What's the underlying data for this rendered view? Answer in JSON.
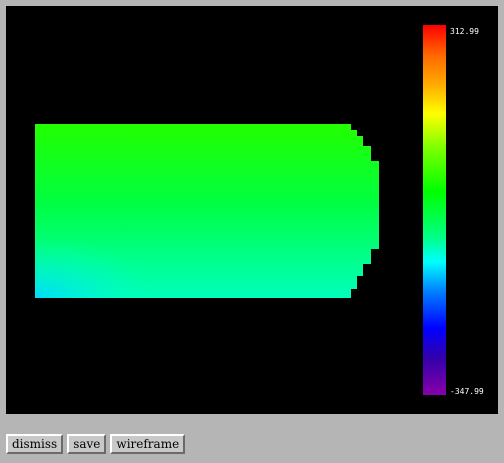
{
  "plot": {
    "colorbar": {
      "max_label": "312.99",
      "min_label": "-347.99",
      "colormap": [
        "#ff0000",
        "#ffff00",
        "#00ff00",
        "#00ffff",
        "#0000ff",
        "#8800aa"
      ]
    },
    "field_colors": {
      "top": "#22ff00",
      "bottom": "#00ffaa",
      "bottom_left_corner": "#00e5ff"
    }
  },
  "buttons": {
    "dismiss": "dismiss",
    "save": "save",
    "wireframe": "wireframe"
  }
}
